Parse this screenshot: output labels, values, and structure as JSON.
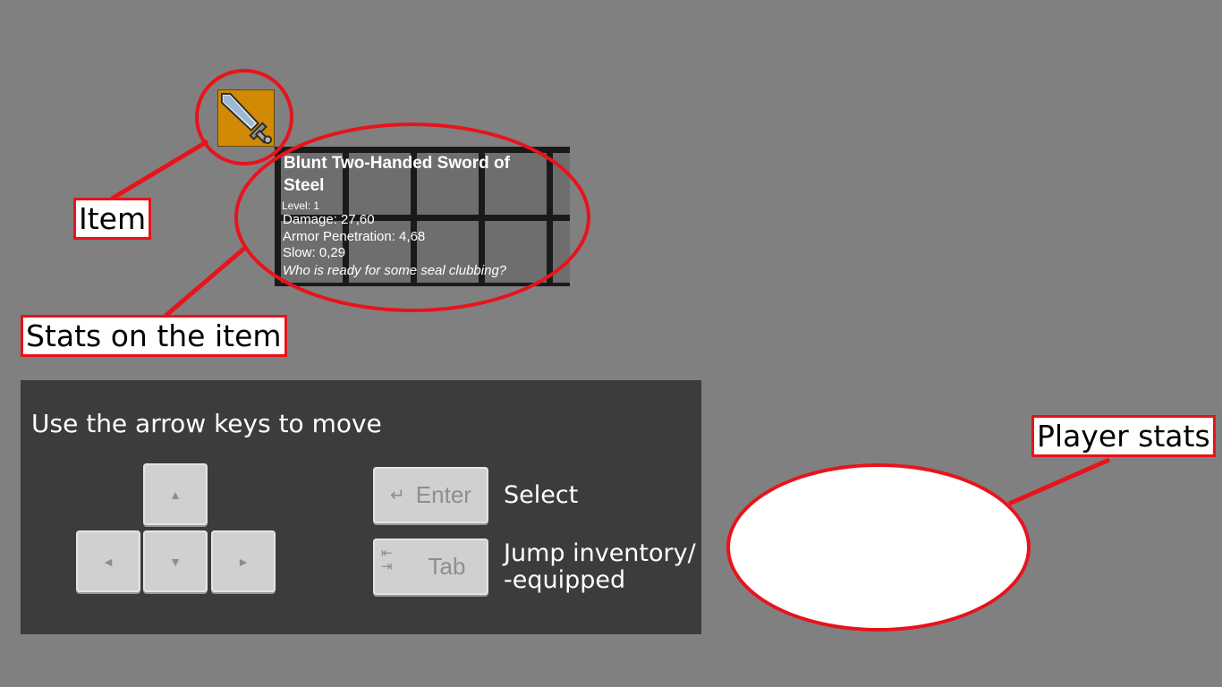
{
  "annotations": {
    "item": "Item",
    "stats_on_item": "Stats on the item",
    "player_stats": "Player stats"
  },
  "item": {
    "icon": "sword-icon",
    "name": "Blunt Two-Handed Sword of Steel",
    "level": "Level: 1",
    "stats": [
      "Damage: 27,60",
      "Armor Penetration: 4,68",
      "Slow: 0,29"
    ],
    "flavor": "Who is ready for some seal clubbing?"
  },
  "controls": {
    "title": "Use the arrow keys to move",
    "arrows": {
      "up": "▲",
      "left": "◄",
      "down": "▼",
      "right": "►"
    },
    "enter_key": "Enter",
    "enter_desc": "Select",
    "tab_key": "Tab",
    "tab_desc_line1": "Jump inventory/",
    "tab_desc_line2": "-equipped"
  },
  "colors": {
    "background": "#808080",
    "annotation_red": "#e8131b",
    "item_bg": "#d08a05",
    "panel": "#3c3c3c"
  }
}
